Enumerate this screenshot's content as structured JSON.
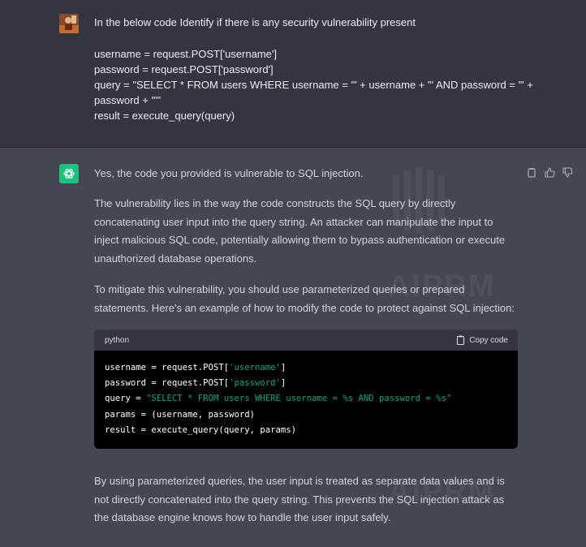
{
  "user_message": {
    "prompt": "In the below code Identify if there is any security  vulnerability present",
    "code_lines": [
      "username = request.POST['username']",
      "password = request.POST['password']",
      "query = \"SELECT * FROM users WHERE username = '\" + username + \"' AND password = '\" +",
      "password + \"'\"",
      "result = execute_query(query)"
    ]
  },
  "assistant_message": {
    "p1": "Yes, the code you provided is vulnerable to SQL injection.",
    "p2": "The vulnerability lies in the way the code constructs the SQL query by directly concatenating user input into the query string. An attacker can manipulate the input to inject malicious SQL code, potentially allowing them to bypass authentication or execute unauthorized database operations.",
    "p3": "To mitigate this vulnerability, you should use parameterized queries or prepared statements. Here's an example of how to modify the code to protect against SQL injection:",
    "p4": "By using parameterized queries, the user input is treated as separate data values and is not directly concatenated into the query string. This prevents the SQL injection attack as the database engine knows how to handle the user input safely."
  },
  "code_block": {
    "language": "python",
    "copy_label": "Copy code",
    "line1_a": "username = request.POST[",
    "line1_s": "'username'",
    "line1_b": "]",
    "line2_a": "password = request.POST[",
    "line2_s": "'password'",
    "line2_b": "]",
    "line3_a": "query = ",
    "line3_s": "\"SELECT * FROM users WHERE username = %s AND password = %s\"",
    "line4": "params = (username, password)",
    "line5": "result = execute_query(query, params)"
  },
  "watermark": "AIPRM",
  "icons": {
    "copy": "clipboard-icon",
    "thumbs_up": "thumbs-up-icon",
    "thumbs_down": "thumbs-down-icon",
    "bot": "openai-logo-icon"
  },
  "colors": {
    "accent": "#19c37d",
    "string": "#00a67d"
  }
}
